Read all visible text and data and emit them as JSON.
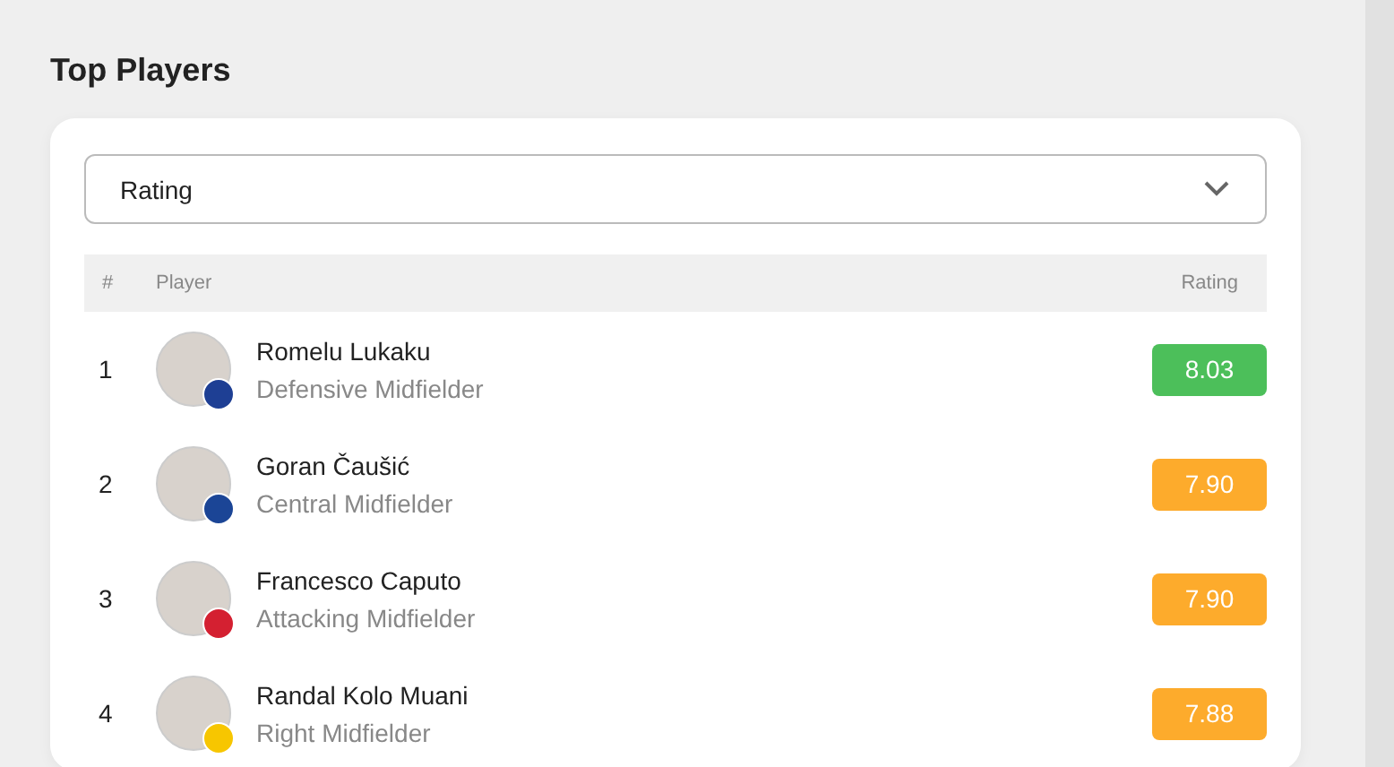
{
  "section_title": "Top Players",
  "sort_select": {
    "value": "Rating"
  },
  "table": {
    "columns": [
      "#",
      "Player",
      "Rating"
    ],
    "rows": [
      {
        "rank": "1",
        "name": "Romelu Lukaku",
        "position": "Defensive Midfielder",
        "rating": "8.03",
        "color": "#4cbf5a"
      },
      {
        "rank": "2",
        "name": "Goran Čaušić",
        "position": "Central Midfielder",
        "rating": "7.90",
        "color": "#fdab2c"
      },
      {
        "rank": "3",
        "name": "Francesco Caputo",
        "position": "Attacking Midfielder",
        "rating": "7.90",
        "color": "#fdab2c"
      },
      {
        "rank": "4",
        "name": "Randal Kolo Muani",
        "position": "Right Midfielder",
        "rating": "7.88",
        "color": "#fdab2c"
      }
    ]
  }
}
